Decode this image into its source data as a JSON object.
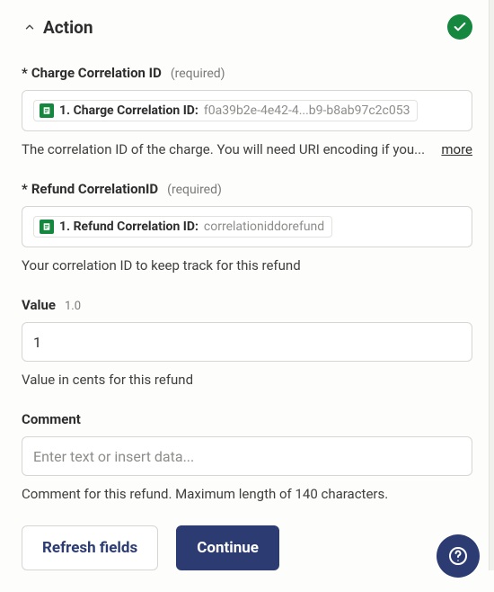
{
  "header": {
    "title": "Action"
  },
  "fields": {
    "charge": {
      "label": "Charge Correlation ID",
      "required_text": "(required)",
      "pill_label": "1. Charge Correlation ID:",
      "pill_value": "f0a39b2e-4e42-4...b9-b8ab97c2c053",
      "help": "The correlation ID of the charge. You will need URI encoding if you...",
      "more": "more"
    },
    "refund": {
      "label": "Refund CorrelationID",
      "required_text": "(required)",
      "pill_label": "1. Refund Correlation ID:",
      "pill_value": "correlationiddorefund",
      "help": "Your correlation ID to keep track for this refund"
    },
    "value": {
      "label": "Value",
      "version": "1.0",
      "value": "1",
      "help": "Value in cents for this refund"
    },
    "comment": {
      "label": "Comment",
      "placeholder": "Enter text or insert data...",
      "help": "Comment for this refund. Maximum length of 140 characters."
    }
  },
  "actions": {
    "refresh": "Refresh fields",
    "continue": "Continue"
  }
}
